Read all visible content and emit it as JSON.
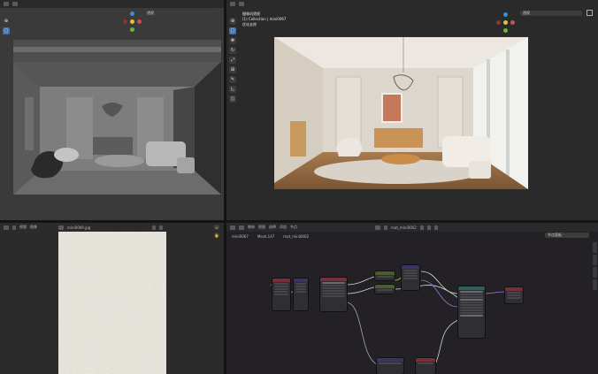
{
  "viewport_left": {
    "header_field": "透视",
    "tools": [
      "cursor-icon",
      "move-icon",
      "rotate-icon",
      "scale-icon",
      "transform-icon",
      "annotate-icon",
      "measure-icon",
      "add-cube-icon"
    ],
    "gizmo_labels": {
      "y": "Y",
      "x": "X",
      "z": "Z"
    }
  },
  "viewport_right": {
    "header_field": "透视",
    "overlay_line1": "摄像机透视",
    "overlay_line2": "(1) Collection | mini0067",
    "overlay_line3": "优化去除",
    "tools": [
      "cursor-icon",
      "move-icon",
      "rotate-icon",
      "scale-icon",
      "transform-icon",
      "annotate-icon",
      "measure-icon",
      "add-cube-icon"
    ]
  },
  "image_editor": {
    "menu": [
      "视图",
      "图像"
    ],
    "image_name": "mini0009.jpg"
  },
  "node_editor": {
    "menu": [
      "物体",
      "视图",
      "选择",
      "添加",
      "节点"
    ],
    "material_name": "mat_mini0002",
    "breadcrumb": [
      "mini0067",
      "Mesh.147",
      "mat_mini0002"
    ],
    "search_field": "节点面板"
  },
  "colors": {
    "header_blue": "#4a72b0",
    "node_red": "#7a2e3a",
    "node_purple": "#3c3461",
    "node_teal": "#2e5f5c",
    "node_green": "#4a5d2c",
    "link_yellow": "#c9c46a",
    "link_grey": "#a8a8a8",
    "link_purple": "#8f7fd6"
  }
}
